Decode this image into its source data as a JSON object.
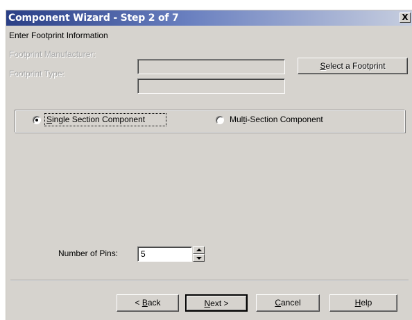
{
  "window": {
    "title": "Component Wizard - Step 2 of 7",
    "close_glyph": "X"
  },
  "header": {
    "instruction": "Enter Footprint Information"
  },
  "footprint": {
    "manufacturer_label": "Footprint Manufacturer:",
    "manufacturer_value": "",
    "type_label": "Footprint Type:",
    "type_value": "",
    "select_button": {
      "prefix": "",
      "mnemonic": "S",
      "rest": "elect a Footprint"
    }
  },
  "section_type": {
    "single": {
      "label_prefix": "",
      "mnemonic": "S",
      "label_rest": "ingle Section Component",
      "selected": true
    },
    "multi": {
      "label_prefix": "Mul",
      "mnemonic": "t",
      "label_rest": "i-Section Component",
      "selected": false
    }
  },
  "pins": {
    "label": "Number of Pins:",
    "value": "5"
  },
  "buttons": {
    "back": {
      "prefix": "< ",
      "mnemonic": "B",
      "rest": "ack"
    },
    "next": {
      "prefix": "",
      "mnemonic": "N",
      "rest": "ext >"
    },
    "cancel": {
      "prefix": "",
      "mnemonic": "C",
      "rest": "ancel"
    },
    "help": {
      "prefix": "",
      "mnemonic": "H",
      "rest": "elp"
    }
  },
  "colors": {
    "dialog_bg": "#d6d3ce",
    "title_start": "#2a3f86",
    "title_end": "#c7cedf",
    "disabled_text": "#a8a8a8"
  },
  "icons": {
    "close": "close-icon",
    "spin_up": "spin-up-arrow-icon",
    "spin_down": "spin-down-arrow-icon"
  }
}
